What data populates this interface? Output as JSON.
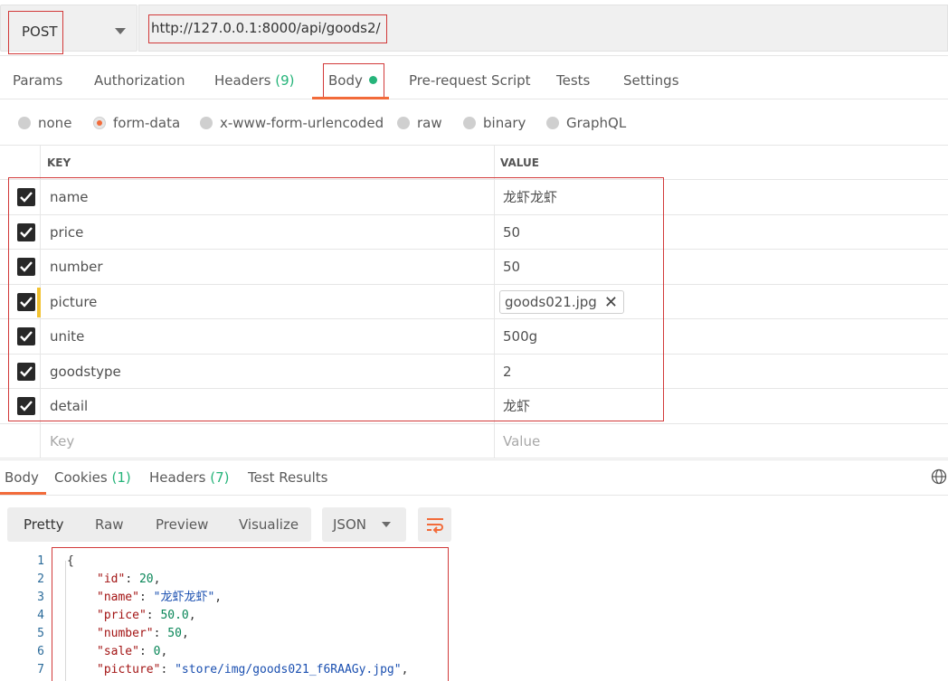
{
  "request": {
    "method": "POST",
    "url": "http://127.0.0.1:8000/api/goods2/"
  },
  "request_tabs": [
    {
      "label": "Params"
    },
    {
      "label": "Authorization"
    },
    {
      "label": "Headers",
      "count": "(9)"
    },
    {
      "label": "Body"
    },
    {
      "label": "Pre-request Script"
    },
    {
      "label": "Tests"
    },
    {
      "label": "Settings"
    }
  ],
  "body_types": [
    "none",
    "form-data",
    "x-www-form-urlencoded",
    "raw",
    "binary",
    "GraphQL"
  ],
  "selected_body_type": "form-data",
  "table": {
    "key_header": "KEY",
    "value_header": "VALUE",
    "rows": [
      {
        "key": "name",
        "value": "龙虾龙虾",
        "checked": true
      },
      {
        "key": "price",
        "value": "50",
        "checked": true
      },
      {
        "key": "number",
        "value": "50",
        "checked": true
      },
      {
        "key": "picture",
        "value": "goods021.jpg",
        "checked": true,
        "type": "file"
      },
      {
        "key": "unite",
        "value": "500g",
        "checked": true
      },
      {
        "key": "goodstype",
        "value": "2",
        "checked": true
      },
      {
        "key": "detail",
        "value": "龙虾",
        "checked": true
      }
    ],
    "key_placeholder": "Key",
    "value_placeholder": "Value"
  },
  "response_tabs": [
    {
      "label": "Body"
    },
    {
      "label": "Cookies",
      "count": "(1)"
    },
    {
      "label": "Headers",
      "count": "(7)"
    },
    {
      "label": "Test Results"
    }
  ],
  "view_modes": [
    "Pretty",
    "Raw",
    "Preview",
    "Visualize"
  ],
  "format": "JSON",
  "code_lines": [
    {
      "n": "1",
      "text": "{"
    },
    {
      "n": "2",
      "k": "\"id\"",
      "v": "20",
      "vt": "n",
      "trail": ","
    },
    {
      "n": "3",
      "k": "\"name\"",
      "v": "\"龙虾龙虾\"",
      "vt": "s",
      "trail": ","
    },
    {
      "n": "4",
      "k": "\"price\"",
      "v": "50.0",
      "vt": "n",
      "trail": ","
    },
    {
      "n": "5",
      "k": "\"number\"",
      "v": "50",
      "vt": "n",
      "trail": ","
    },
    {
      "n": "6",
      "k": "\"sale\"",
      "v": "0",
      "vt": "n",
      "trail": ","
    },
    {
      "n": "7",
      "k": "\"picture\"",
      "v": "\"store/img/goods021_f6RAAGy.jpg\"",
      "vt": "s",
      "trail": ","
    }
  ],
  "colors": {
    "accent": "#f26b3a",
    "count_green": "#26b47a",
    "highlight_red": "#d23a3a",
    "checkbox": "#282828"
  }
}
